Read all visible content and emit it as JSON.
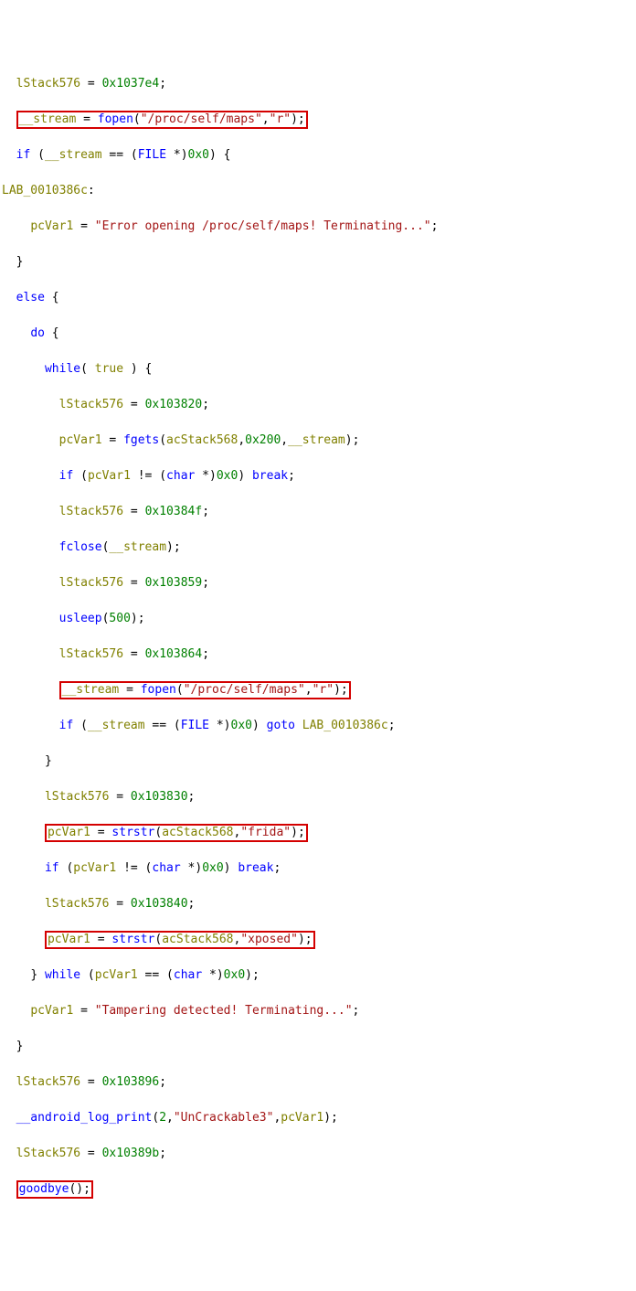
{
  "code": {
    "l0": {
      "indent": "  ",
      "var": "lStack576",
      "op": " = ",
      "val": "0x1037e4",
      "end": ";"
    },
    "l1": {
      "indent": "  ",
      "lhs": "__stream",
      "op": " = ",
      "fn": "fopen",
      "args_open": "(",
      "arg1": "\"/proc/self/maps\"",
      "comma": ",",
      "arg2": "\"r\"",
      "args_close": ");"
    },
    "l2": {
      "indent": "  ",
      "kw_if": "if",
      "p1": " (",
      "var": "__stream",
      "op": " == (",
      "type": "FILE",
      "p2": " *)",
      "zero": "0x0",
      "p3": ") {"
    },
    "l3": {
      "label": "LAB_0010386c",
      "colon": ":"
    },
    "l4": {
      "indent": "    ",
      "var": "pcVar1",
      "op": " = ",
      "str": "\"Error opening /proc/self/maps! Terminating...\"",
      "end": ";"
    },
    "l5": {
      "indent": "  ",
      "brace": "}"
    },
    "l6": {
      "indent": "  ",
      "kw": "else",
      "brace": " {"
    },
    "l7": {
      "indent": "    ",
      "kw": "do",
      "brace": " {"
    },
    "l8": {
      "indent": "      ",
      "kw": "while",
      "p1": "( ",
      "tru": "true",
      "p2": " ) {"
    },
    "l9": {
      "indent": "        ",
      "var": "lStack576",
      "op": " = ",
      "val": "0x103820",
      "end": ";"
    },
    "l10": {
      "indent": "        ",
      "lhs": "pcVar1",
      "op": " = ",
      "fn": "fgets",
      "p1": "(",
      "a1": "acStack568",
      "c1": ",",
      "a2": "0x200",
      "c2": ",",
      "a3": "__stream",
      "p2": ");"
    },
    "l11": {
      "indent": "        ",
      "kw_if": "if",
      "p1": " (",
      "var": "pcVar1",
      "op": " != (",
      "type": "char",
      "p2": " *)",
      "zero": "0x0",
      "p3": ") ",
      "kw_brk": "break",
      "end": ";"
    },
    "l12": {
      "indent": "        ",
      "var": "lStack576",
      "op": " = ",
      "val": "0x10384f",
      "end": ";"
    },
    "l13": {
      "indent": "        ",
      "fn": "fclose",
      "p1": "(",
      "a1": "__stream",
      "p2": ");"
    },
    "l14": {
      "indent": "        ",
      "var": "lStack576",
      "op": " = ",
      "val": "0x103859",
      "end": ";"
    },
    "l15": {
      "indent": "        ",
      "fn": "usleep",
      "p1": "(",
      "a1": "500",
      "p2": ");"
    },
    "l16": {
      "indent": "        ",
      "var": "lStack576",
      "op": " = ",
      "val": "0x103864",
      "end": ";"
    },
    "l17": {
      "indent": "        ",
      "lead": "__",
      "lhs": "stream",
      "op": " = ",
      "fn": "fopen",
      "p1": "(",
      "a1": "\"/proc/self/maps\"",
      "c1": ",",
      "a2": "\"r\"",
      "p2": ");"
    },
    "l18": {
      "indent": "        ",
      "kw_if": "if",
      "p1": " (",
      "var": "__stream",
      "op": " == (",
      "type": "FILE",
      "p2": " *)",
      "zero": "0x0",
      "p3": ") ",
      "kw_goto": "goto",
      "lbl": " LAB_0010386c",
      "end": ";"
    },
    "l19": {
      "indent": "      ",
      "brace": "}"
    },
    "l20": {
      "indent": "      ",
      "var": "lStack576",
      "op": " = ",
      "val": "0x103830",
      "end": ";"
    },
    "l21": {
      "indent": "      ",
      "lhs": "pcVar1",
      "op": " = ",
      "fn": "strstr",
      "p1": "(",
      "a1": "acStack568",
      "c1": ",",
      "a2": "\"frida\"",
      "p2": ");"
    },
    "l22": {
      "indent": "      ",
      "kw_if": "if",
      "p1": " (",
      "var": "pcVar1",
      "op": " != (",
      "type": "char",
      "p2": " *)",
      "zero": "0x0",
      "p3": ") ",
      "kw_brk": "break",
      "end": ";"
    },
    "l23": {
      "indent": "      ",
      "var": "lStack576",
      "op": " = ",
      "val": "0x103840",
      "end": ";"
    },
    "l24": {
      "indent": "      ",
      "lhs": "pcVar1",
      "op": " = ",
      "fn": "strstr",
      "p1": "(",
      "a1": "acStack568",
      "c1": ",",
      "a2": "\"xposed\"",
      "p2": ");"
    },
    "l25": {
      "indent": "    ",
      "brace": "} ",
      "kw": "while",
      "p1": " (",
      "var": "pcVar1",
      "op": " == (",
      "type": "char",
      "p2": " *)",
      "zero": "0x0",
      "p3": ");"
    },
    "l26": {
      "indent": "    ",
      "var": "pcVar1",
      "op": " = ",
      "str": "\"Tampering detected! Terminating...\"",
      "end": ";"
    },
    "l27": {
      "indent": "  ",
      "brace": "}"
    },
    "l28": {
      "indent": "  ",
      "var": "lStack576",
      "op": " = ",
      "val": "0x103896",
      "end": ";"
    },
    "l29": {
      "indent": "  ",
      "fn": "__android_log_print",
      "p1": "(",
      "a1": "2",
      "c1": ",",
      "a2": "\"UnCrackable3\"",
      "c2": ",",
      "a3": "pcVar1",
      "p2": ");"
    },
    "l30": {
      "indent": "  ",
      "var": "lStack576",
      "op": " = ",
      "val": "0x10389b",
      "end": ";"
    },
    "l31": {
      "indent": "  ",
      "fn": "goodbye",
      "p1": "();"
    }
  }
}
